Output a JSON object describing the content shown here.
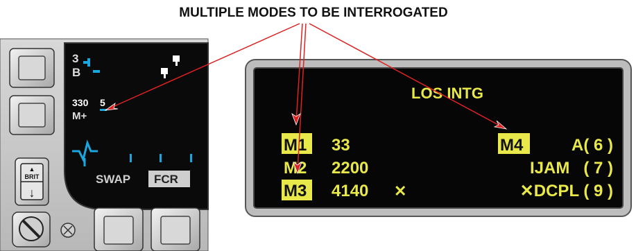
{
  "caption": "MULTIPLE MODES TO BE INTERROGATED",
  "mfd": {
    "channel_top": "3",
    "channel_bottom": "B",
    "range_readout": "330",
    "range_value": "5",
    "mode_label": "M+",
    "swap_label": "SWAP",
    "fcr_label": "FCR",
    "brit_label": "BRIT",
    "brit_up": "▲",
    "brit_down": "↓"
  },
  "ufc": {
    "title": "LOS INTG",
    "rows": [
      {
        "mode": "M1",
        "code": "33",
        "extra": "",
        "right_mode": "M4",
        "right_value": "A( 6 )"
      },
      {
        "mode": "M2",
        "code": "2200",
        "extra": "",
        "right_mode": "",
        "right_value": "IJAM   ( 7 )"
      },
      {
        "mode": "M3",
        "code": "4140",
        "extra": "✕",
        "right_mode": "",
        "right_value": "✕DCPL ( 9 )"
      }
    ]
  },
  "colors": {
    "display_text": "#e8e84a",
    "highlight_box": "#e8e84a",
    "highlight_text": "#111111",
    "arrow": "#dd2222",
    "radar_cyan": "#1aa7e0",
    "bezel": "#c8c8c8"
  }
}
